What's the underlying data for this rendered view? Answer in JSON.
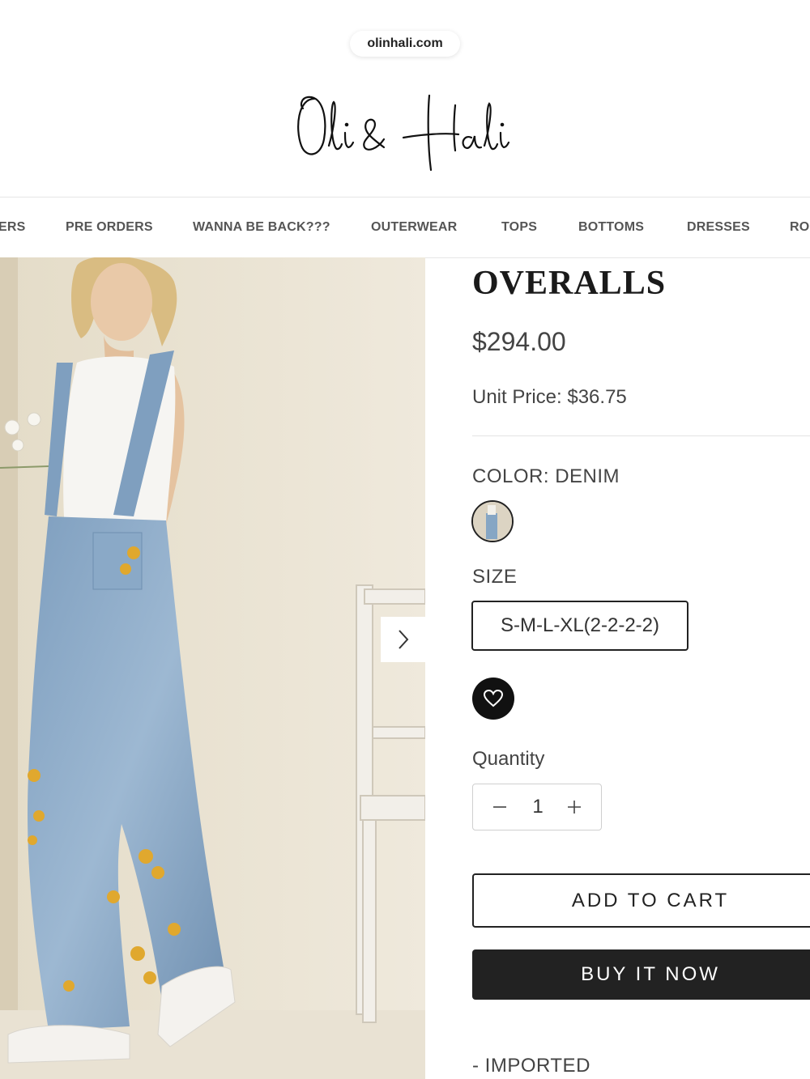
{
  "browser": {
    "url": "olinhali.com"
  },
  "brand": {
    "logo_text": "Oli & Hali"
  },
  "nav": {
    "items": [
      "ERS",
      "PRE ORDERS",
      "WANNA BE BACK???",
      "OUTERWEAR",
      "TOPS",
      "BOTTOMS",
      "DRESSES",
      "RO"
    ]
  },
  "product": {
    "title": "OVERALLS",
    "price": "$294.00",
    "unit_price": "Unit Price: $36.75",
    "color_label": "COLOR:",
    "color_value": "DENIM",
    "size_label": "SIZE",
    "size_option": "S-M-L-XL(2-2-2-2)",
    "quantity_label": "Quantity",
    "quantity_value": "1",
    "add_to_cart": "ADD TO CART",
    "buy_it_now": "BUY IT NOW",
    "detail_line": "- IMPORTED"
  },
  "icons": {
    "gallery_next": "chevron-right-icon",
    "wishlist": "heart-icon",
    "qty_minus": "minus-icon",
    "qty_plus": "plus-icon"
  },
  "colors": {
    "button_dark": "#222222",
    "text_gray": "#444444"
  }
}
